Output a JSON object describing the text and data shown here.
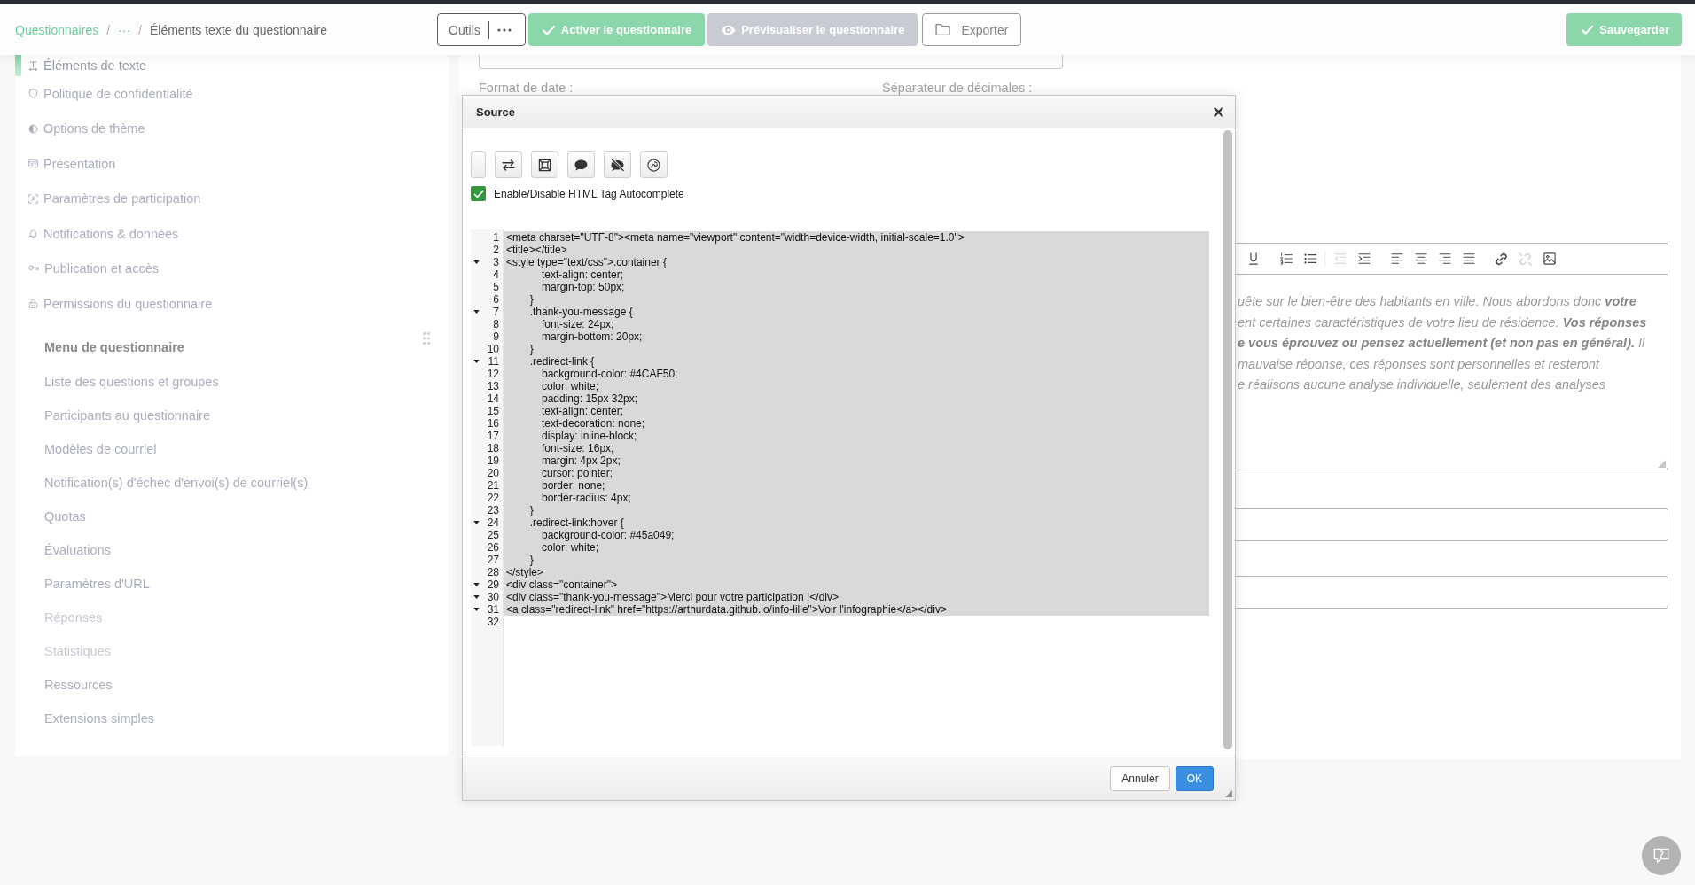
{
  "header": {
    "breadcrumb": [
      {
        "kind": "link",
        "label": "Questionnaires"
      },
      {
        "kind": "separator",
        "label": "/"
      },
      {
        "kind": "link",
        "label": "···"
      },
      {
        "kind": "separator",
        "label": "/"
      },
      {
        "kind": "current",
        "label": "Éléments texte du questionnaire"
      }
    ],
    "tools": {
      "label": "Outils"
    },
    "buttons": [
      {
        "kind": "activate",
        "label": "Activer le questionnaire",
        "disabled": false
      },
      {
        "kind": "preview",
        "label": "Prévisualiser le questionnaire",
        "disabled": true
      },
      {
        "kind": "export",
        "label": "Exporter",
        "disabled": false
      }
    ],
    "save_button": {
      "label": "Sauvegarder"
    }
  },
  "sidebar": {
    "settings": [
      {
        "label": "Éléments de texte",
        "selected": true
      },
      {
        "label": "Politique de confidentialité",
        "selected": false
      },
      {
        "label": "Options de thème",
        "selected": false
      },
      {
        "label": "Présentation",
        "selected": false
      },
      {
        "label": "Paramètres de participation",
        "selected": false
      },
      {
        "label": "Notifications & données",
        "selected": false
      },
      {
        "label": "Publication et accès",
        "selected": false
      },
      {
        "label": "Permissions du questionnaire",
        "selected": false
      }
    ],
    "menu_title": "Menu de questionnaire",
    "menu": [
      {
        "label": "Liste des questions et groupes",
        "disabled": false
      },
      {
        "label": "Participants au questionnaire",
        "disabled": false
      },
      {
        "label": "Modèles de courriel",
        "disabled": false
      },
      {
        "label": "Notification(s) d'échec d'envoi(s) de courriel(s)",
        "disabled": false
      },
      {
        "label": "Quotas",
        "disabled": false
      },
      {
        "label": "Évaluations",
        "disabled": false
      },
      {
        "label": "Paramètres d'URL",
        "disabled": false
      },
      {
        "label": "Réponses",
        "disabled": true
      },
      {
        "label": "Statistiques",
        "disabled": true
      },
      {
        "label": "Ressources",
        "disabled": false
      },
      {
        "label": "Extensions simples",
        "disabled": false
      }
    ]
  },
  "form": {
    "date_format_label": "Format de date :",
    "decimal_separator_label": "Séparateur de décimales :",
    "editor": {
      "toolbar": [
        {
          "kind": "underline",
          "disabled": false
        },
        {
          "kind": "ordered-list",
          "disabled": false
        },
        {
          "kind": "bullet-list",
          "disabled": false
        },
        {
          "kind": "outdent",
          "disabled": true
        },
        {
          "kind": "indent",
          "disabled": false
        },
        {
          "kind": "align-left",
          "disabled": false
        },
        {
          "kind": "align-center",
          "disabled": false
        },
        {
          "kind": "align-right",
          "disabled": false
        },
        {
          "kind": "align-justify",
          "disabled": false
        },
        {
          "kind": "link",
          "disabled": false
        },
        {
          "kind": "unlink",
          "disabled": true
        },
        {
          "kind": "image",
          "disabled": false
        }
      ],
      "lines": [
        "uête sur le bien-être des habitants en ville. Nous abordons donc **votre**",
        "ent certaines caractéristiques de votre lieu de résidence. **Vos réponses**",
        "**e vous éprouvez ou pensez actuellement (et non pas en général).** Il",
        "mauvaise réponse, ces réponses sont personnelles et resteront",
        "e réalisons aucune analyse individuelle, seulement des analyses"
      ]
    }
  },
  "dialog": {
    "title": "Source",
    "autocomplete": {
      "label": "Enable/Disable HTML Tag Autocomplete",
      "checked": true
    },
    "code": {
      "lines": [
        {
          "number": "1",
          "text": "<meta charset=\"UTF-8\"><meta name=\"viewport\" content=\"width=device-width, initial-scale=1.0\">",
          "foldable": false,
          "selected": true
        },
        {
          "number": "2",
          "text": "<title></title>",
          "foldable": false,
          "selected": true
        },
        {
          "number": "3",
          "text": "<style type=\"text/css\">.container {",
          "foldable": true,
          "selected": true
        },
        {
          "number": "4",
          "text": "            text-align: center;",
          "foldable": false,
          "selected": true
        },
        {
          "number": "5",
          "text": "            margin-top: 50px;",
          "foldable": false,
          "selected": true
        },
        {
          "number": "6",
          "text": "        }",
          "foldable": false,
          "selected": true
        },
        {
          "number": "7",
          "text": "        .thank-you-message {",
          "foldable": true,
          "selected": true
        },
        {
          "number": "8",
          "text": "            font-size: 24px;",
          "foldable": false,
          "selected": true
        },
        {
          "number": "9",
          "text": "            margin-bottom: 20px;",
          "foldable": false,
          "selected": true
        },
        {
          "number": "10",
          "text": "        }",
          "foldable": false,
          "selected": true
        },
        {
          "number": "11",
          "text": "        .redirect-link {",
          "foldable": true,
          "selected": true
        },
        {
          "number": "12",
          "text": "            background-color: #4CAF50;",
          "foldable": false,
          "selected": true
        },
        {
          "number": "13",
          "text": "            color: white;",
          "foldable": false,
          "selected": true
        },
        {
          "number": "14",
          "text": "            padding: 15px 32px;",
          "foldable": false,
          "selected": true
        },
        {
          "number": "15",
          "text": "            text-align: center;",
          "foldable": false,
          "selected": true
        },
        {
          "number": "16",
          "text": "            text-decoration: none;",
          "foldable": false,
          "selected": true
        },
        {
          "number": "17",
          "text": "            display: inline-block;",
          "foldable": false,
          "selected": true
        },
        {
          "number": "18",
          "text": "            font-size: 16px;",
          "foldable": false,
          "selected": true
        },
        {
          "number": "19",
          "text": "            margin: 4px 2px;",
          "foldable": false,
          "selected": true
        },
        {
          "number": "20",
          "text": "            cursor: pointer;",
          "foldable": false,
          "selected": true
        },
        {
          "number": "21",
          "text": "            border: none;",
          "foldable": false,
          "selected": true
        },
        {
          "number": "22",
          "text": "            border-radius: 4px;",
          "foldable": false,
          "selected": true
        },
        {
          "number": "23",
          "text": "        }",
          "foldable": false,
          "selected": true
        },
        {
          "number": "24",
          "text": "        .redirect-link:hover {",
          "foldable": true,
          "selected": true
        },
        {
          "number": "25",
          "text": "            background-color: #45a049;",
          "foldable": false,
          "selected": true
        },
        {
          "number": "26",
          "text": "            color: white;",
          "foldable": false,
          "selected": true
        },
        {
          "number": "27",
          "text": "        }",
          "foldable": false,
          "selected": true
        },
        {
          "number": "28",
          "text": "</style>",
          "foldable": false,
          "selected": true
        },
        {
          "number": "29",
          "text": "<div class=\"container\">",
          "foldable": true,
          "selected": true
        },
        {
          "number": "30",
          "text": "<div class=\"thank-you-message\">Merci pour votre participation !</div>",
          "foldable": true,
          "selected": true
        },
        {
          "number": "31",
          "text": "<a class=\"redirect-link\" href=\"https://arthurdata.github.io/info-lille\">Voir l'infographie</a></div>",
          "foldable": true,
          "selected": true
        },
        {
          "number": "32",
          "foldable": false,
          "selected": false
        }
      ]
    },
    "buttons": [
      {
        "kind": "cancel",
        "label": "Annuler"
      },
      {
        "kind": "ok",
        "label": "OK"
      }
    ]
  }
}
